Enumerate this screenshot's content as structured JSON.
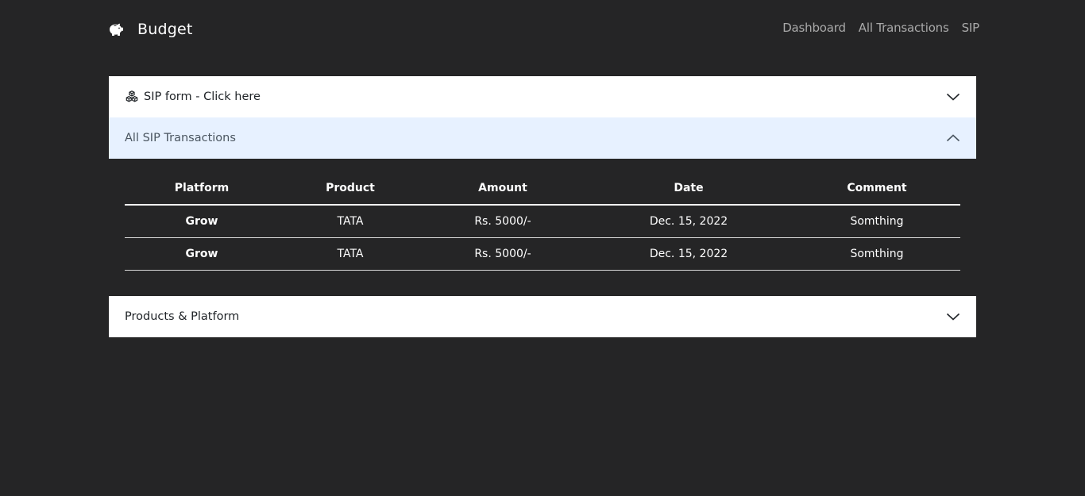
{
  "brand": {
    "icon": "piggy-bank-icon",
    "name": "Budget"
  },
  "nav": {
    "links": [
      "Dashboard",
      "All Transactions",
      "SIP"
    ]
  },
  "accordion": {
    "sip_form": {
      "icon": "boxes-icon",
      "label": "SIP form - Click here",
      "expanded": false
    },
    "transactions": {
      "label": "All SIP Transactions",
      "expanded": true,
      "columns": [
        "Platform",
        "Product",
        "Amount",
        "Date",
        "Comment"
      ],
      "rows": [
        [
          "Grow",
          "TATA",
          "Rs. 5000/-",
          "Dec. 15, 2022",
          "Somthing"
        ],
        [
          "Grow",
          "TATA",
          "Rs. 5000/-",
          "Dec. 15, 2022",
          "Somthing"
        ]
      ]
    },
    "products": {
      "label": "Products & Platform",
      "expanded": false
    }
  },
  "colors": {
    "background": "#252526",
    "active_header_bg": "#e7f1ff",
    "nav_link": "#a9a9a9"
  }
}
